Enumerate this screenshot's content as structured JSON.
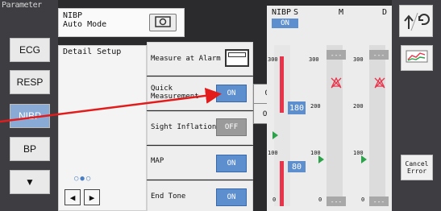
{
  "sidebar": {
    "title": "Parameter",
    "items": [
      {
        "label": "ECG"
      },
      {
        "label": "RESP"
      },
      {
        "label": "NIBP"
      },
      {
        "label": "BP"
      },
      {
        "label": "▼"
      }
    ]
  },
  "header": {
    "title": "NIBP\nAuto Mode"
  },
  "detail": {
    "title": "Detail Setup",
    "pager_dots": "○●○",
    "prev_label": "◀",
    "next_label": "▶",
    "rows": [
      {
        "label": "Measure at Alarm"
      },
      {
        "label": "Quick\nMeasurement",
        "value": "ON"
      },
      {
        "label": "Sight Inflation",
        "value": "OFF"
      },
      {
        "label": "MAP",
        "value": "ON"
      },
      {
        "label": "End Tone",
        "value": "ON"
      }
    ]
  },
  "popup": {
    "options": [
      "ON",
      "OFF"
    ]
  },
  "nibp": {
    "title": "NIBP",
    "s_label": "S",
    "m_label": "M",
    "d_label": "D",
    "state": "ON",
    "value_box_1": "180",
    "value_box_2": "80",
    "ticks": {
      "s": [
        "300",
        "100",
        "0"
      ],
      "m": [
        "300",
        "200",
        "100",
        "0"
      ],
      "d": [
        "300",
        "200",
        "100",
        "0"
      ]
    },
    "placeholders": [
      "---",
      "---",
      "---",
      "---"
    ]
  },
  "right": {
    "cancel_label": "Cancel\nError"
  },
  "colors": {
    "accent": "#5d8fcf",
    "alarm_red": "#e8334a",
    "indicator_green": "#2ca24a",
    "annotation_arrow": "#e31b1b"
  }
}
